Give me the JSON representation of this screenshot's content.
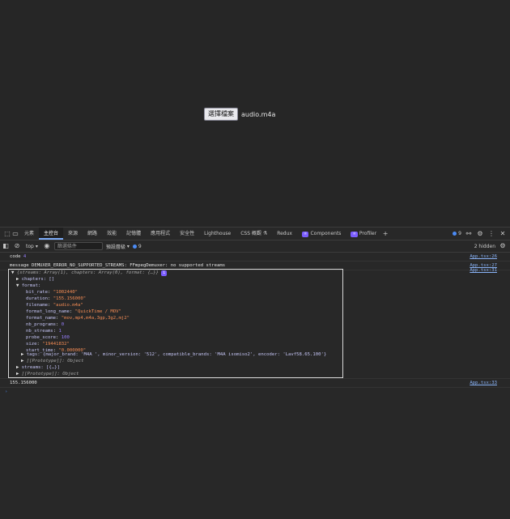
{
  "page": {
    "file_button": "選擇檔案",
    "file_name": "audio.m4a"
  },
  "devtools": {
    "tabs": [
      "元素",
      "主控台",
      "來源",
      "網路",
      "效能",
      "記憶體",
      "應用程式",
      "安全性",
      "Lighthouse",
      "CSS 概觀 ⚗",
      "Redux",
      "Components",
      "Profiler"
    ],
    "active_tab": "主控台",
    "issues_count": "9",
    "toolbar": {
      "context": "top",
      "filter_placeholder": "篩選條件",
      "levels": "預設層級",
      "issue_badge": "9",
      "hidden": "2 hidden"
    },
    "console": {
      "row1": {
        "key": "code",
        "value": "4",
        "src": "App.tsx:26"
      },
      "row2": {
        "key": "message",
        "value": "DEMUXER_ERROR_NO_SUPPORTED_STREAMS: FFmpegDemuxer: no supported streams",
        "src": "App.tsx:27"
      },
      "obj_src": "App.tsx:31",
      "obj_summary": "{streams: Array(1), chapters: Array(0), format: {…}}",
      "chapters": "chapters: []",
      "format_label": "format:",
      "fields": [
        {
          "k": "bit_rate",
          "v": "\"1002440\"",
          "t": "str"
        },
        {
          "k": "duration",
          "v": "\"155.156000\"",
          "t": "str"
        },
        {
          "k": "filename",
          "v": "\"audio.m4a\"",
          "t": "str"
        },
        {
          "k": "format_long_name",
          "v": "\"QuickTime / MOV\"",
          "t": "str"
        },
        {
          "k": "format_name",
          "v": "\"mov,mp4,m4a,3gp,3g2,mj2\"",
          "t": "str"
        },
        {
          "k": "nb_programs",
          "v": "0",
          "t": "num"
        },
        {
          "k": "nb_streams",
          "v": "1",
          "t": "num"
        },
        {
          "k": "probe_score",
          "v": "100",
          "t": "num"
        },
        {
          "k": "size",
          "v": "\"19441832\"",
          "t": "str"
        },
        {
          "k": "start_time",
          "v": "\"0.000000\"",
          "t": "str"
        }
      ],
      "tags": "tags: {major_brand: 'M4A ', minor_version: '512', compatible_brands: 'M4A isomiso2', encoder: 'Lavf58.65.100'}",
      "proto1": "[[Prototype]]: Object",
      "streams": "streams: [{…}]",
      "proto2": "[[Prototype]]: Object",
      "row_last": {
        "value": "155.156000",
        "src": "App.tsx:33"
      },
      "prompt": "›"
    }
  }
}
